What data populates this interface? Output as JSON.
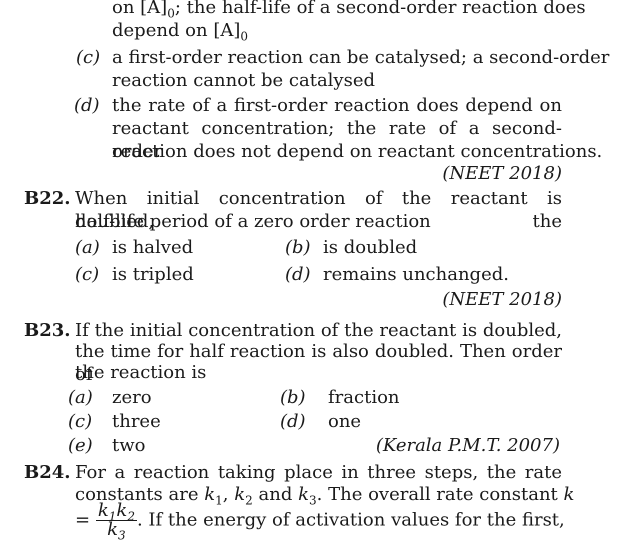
{
  "watermark": "grey diagonal band",
  "top": {
    "line1_a": "on [A]",
    "line1_sub": "0",
    "line1_b": "; the half-life of a second-order reaction does",
    "line2_a": "depend on [A]",
    "line2_sub": "0",
    "c_label": "(c)",
    "c_line1": "a first-order reaction can be catalysed; a second-order",
    "c_line2": "reaction cannot be catalysed",
    "d_label": "(d)",
    "d_line1": "the rate of a first-order reaction does depend on",
    "d_line2": "reactant concentration; the rate of a second-order",
    "d_line3": "reaction does not depend on reactant concentrations.",
    "source": "(NEET 2018)"
  },
  "b22": {
    "num": "B22.",
    "line1": "When initial concentration of the reactant is doubled, the",
    "line2": "half-life period of a zero order reaction",
    "a_label": "(a)",
    "a_text": "is halved",
    "b_label": "(b)",
    "b_text": "is doubled",
    "c_label": "(c)",
    "c_text": "is tripled",
    "d_label": "(d)",
    "d_text": "remains unchanged.",
    "source": "(NEET 2018)"
  },
  "b23": {
    "num": "B23.",
    "line1": "If the initial concentration of the reactant is doubled,",
    "line2": "the time for half reaction is also doubled. Then order of",
    "line3": "the reaction is",
    "a_label": "(a)",
    "a_text": "zero",
    "b_label": "(b)",
    "b_text": "fraction",
    "c_label": "(c)",
    "c_text": "three",
    "d_label": "(d)",
    "d_text": "one",
    "e_label": "(e)",
    "e_text": "two",
    "source": "(Kerala P.M.T. 2007)"
  },
  "b24": {
    "num": "B24.",
    "line1": "For a reaction taking place in three steps, the rate",
    "line2_a": "constants are ",
    "k": "k",
    "s1": "1",
    "comma": ", ",
    "s2": "2",
    "and": " and ",
    "s3": "3",
    "line2_b": ". The overall rate constant ",
    "eq": "=",
    "frac_num": "k",
    "frac_den": "k",
    "line3_b": ". If the energy of activation values for the first,"
  }
}
